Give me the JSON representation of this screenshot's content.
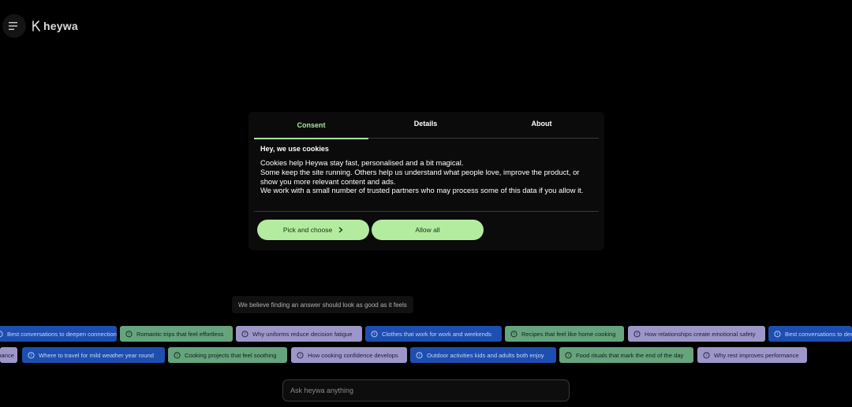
{
  "header": {
    "logo_text": "heywa",
    "menu_icon": "hamburger-menu-icon",
    "logo_icon": "heywa-logo-icon"
  },
  "consent": {
    "tabs": [
      {
        "label": "Consent",
        "active": true
      },
      {
        "label": "Details",
        "active": false
      },
      {
        "label": "About",
        "active": false
      }
    ],
    "heading": "Hey, we use cookies",
    "body": [
      "Cookies help Heywa stay fast, personalised and a bit magical.",
      "Some keep the site running. Others help us understand what people love, improve the product, or show you more relevant content and ads.",
      "We work with a small number of trusted partners who may process some of this data if you allow it."
    ],
    "pick_label": "Pick and choose",
    "allow_label": "Allow all"
  },
  "tagline": "We believe finding an answer should look as good as it feels",
  "chips_row1": [
    {
      "text": "Best conversations to deepen connection",
      "color": "blue"
    },
    {
      "text": "Romantic trips that feel effortless",
      "color": "green"
    },
    {
      "text": "Why uniforms reduce decision fatigue",
      "color": "lavender"
    },
    {
      "text": "Clothes that work for work and weekends",
      "color": "blue"
    },
    {
      "text": "Recipes that feel like home cooking",
      "color": "green"
    },
    {
      "text": "How relationships create emotional safety",
      "color": "lavender"
    },
    {
      "text": "Best conversations to deepen connection",
      "color": "blue"
    }
  ],
  "chips_row2": [
    {
      "text": "Why rest improves performance",
      "color": "lavender"
    },
    {
      "text": "Where to travel for mild weather year round",
      "color": "blue"
    },
    {
      "text": "Cooking projects that feel soothing",
      "color": "green"
    },
    {
      "text": "How cooking confidence develops",
      "color": "lavender"
    },
    {
      "text": "Outdoor activities kids and adults both enjoy",
      "color": "blue"
    },
    {
      "text": "Food rituals that mark the end of the day",
      "color": "green"
    },
    {
      "text": "Why rest improves performance",
      "color": "lavender"
    }
  ],
  "ask": {
    "placeholder": "Ask heywa anything",
    "value": ""
  },
  "colors": {
    "accent_green": "#a8e6a0",
    "button_green": "#b3ec9f",
    "chip_blue": "#1d4fb0",
    "chip_green": "#66a47e",
    "chip_lavender": "#9d97c9"
  }
}
